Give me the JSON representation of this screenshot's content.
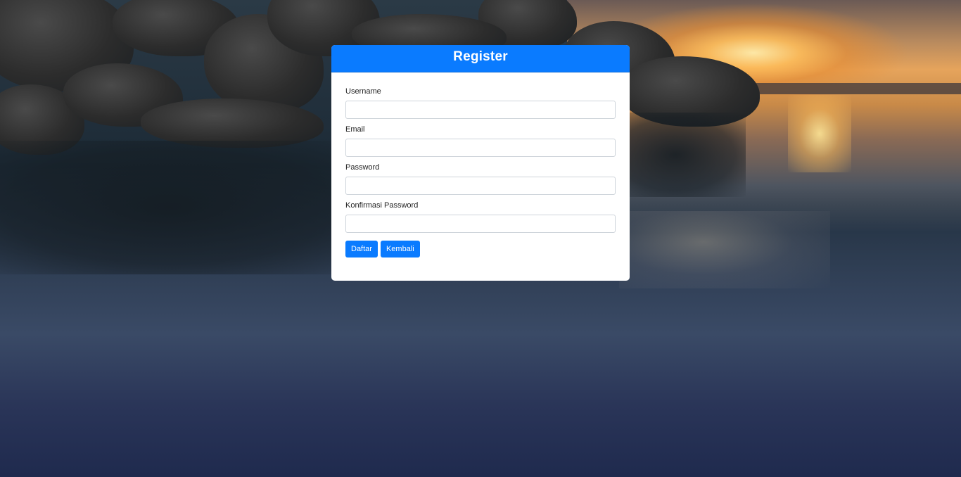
{
  "page": {
    "title": "Register"
  },
  "form": {
    "fields": [
      {
        "label": "Username",
        "value": "",
        "placeholder": ""
      },
      {
        "label": "Email",
        "value": "",
        "placeholder": ""
      },
      {
        "label": "Password",
        "value": "",
        "placeholder": ""
      },
      {
        "label": "Konfirmasi Password",
        "value": "",
        "placeholder": ""
      }
    ],
    "submit_label": "Daftar",
    "back_label": "Kembali"
  },
  "colors": {
    "accent": "#0a7bff",
    "card_background": "#ffffff"
  }
}
